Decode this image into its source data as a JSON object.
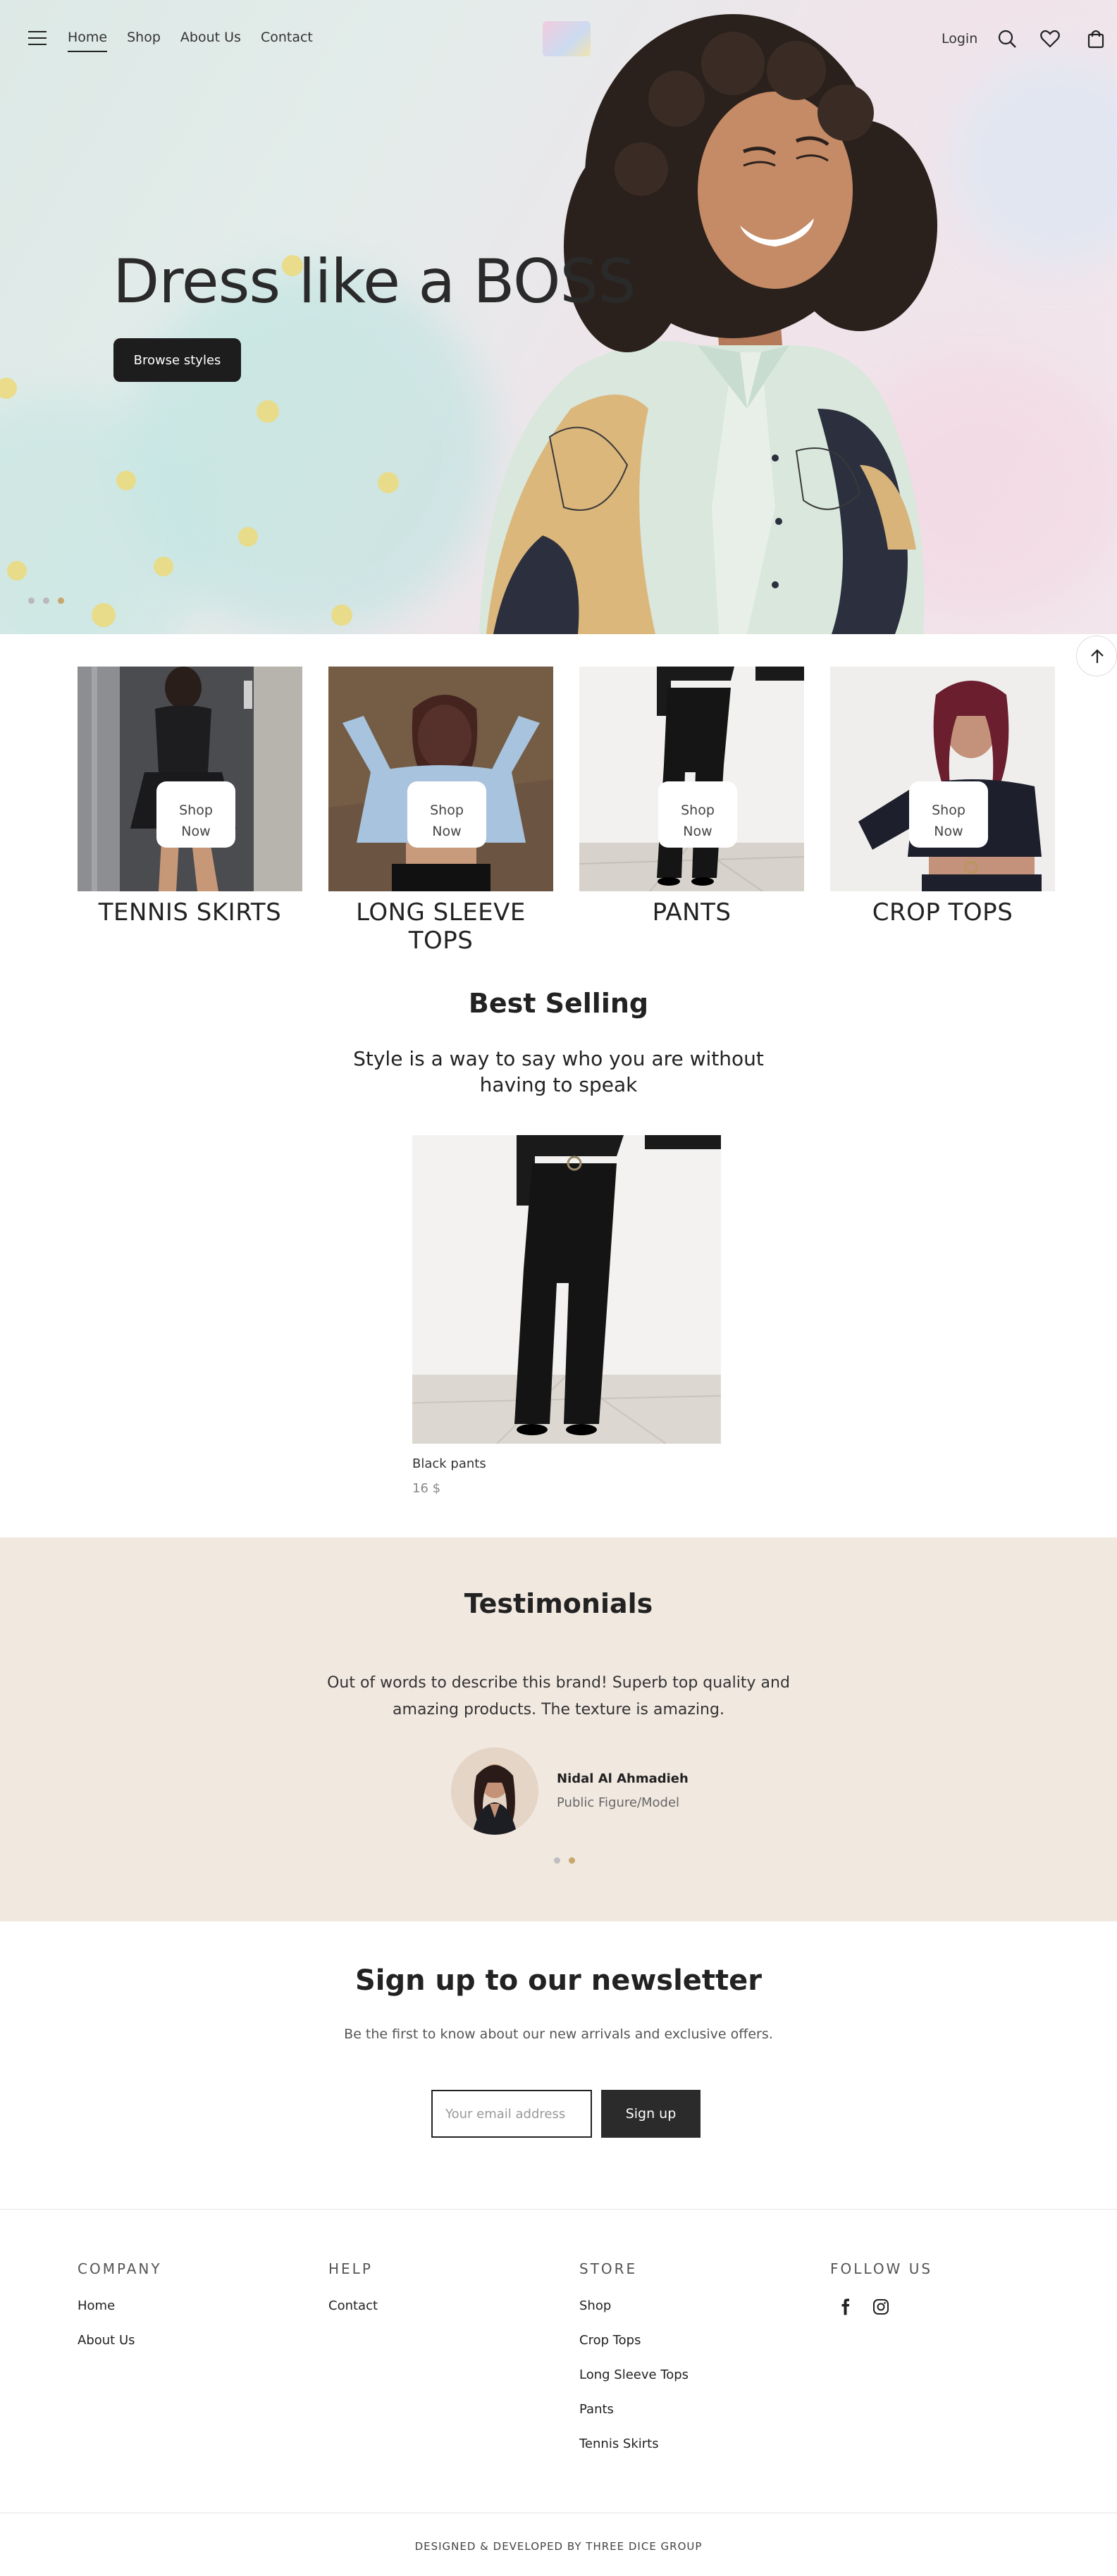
{
  "nav": {
    "links": [
      "Home",
      "Shop",
      "About Us",
      "Contact"
    ],
    "active": "Home",
    "login": "Login",
    "icons": [
      "menu-icon",
      "search-icon",
      "heart-icon",
      "cart-icon"
    ]
  },
  "hero": {
    "title": "Dress like a BOSS",
    "button": "Browse styles",
    "slides": 3,
    "active_slide": 3
  },
  "categories": [
    {
      "name": "TENNIS SKIRTS",
      "button": "Shop\nNow"
    },
    {
      "name": "LONG SLEEVE TOPS",
      "button": "Shop\nNow"
    },
    {
      "name": "PANTS",
      "button": "Shop\nNow"
    },
    {
      "name": "CROP TOPS",
      "button": "Shop\nNow"
    }
  ],
  "best_selling": {
    "title": "Best Selling",
    "subtitle": "Style is a way to say who you are without having to speak",
    "products": [
      {
        "name": "Black pants",
        "price": "16 $"
      }
    ]
  },
  "testimonials": {
    "title": "Testimonials",
    "quote": "Out of words to describe this brand! Superb top quality and amazing products. The texture is amazing.",
    "author": "Nidal Al Ahmadieh",
    "role": "Public Figure/Model",
    "slides": 2,
    "active_slide": 2
  },
  "newsletter": {
    "title": "Sign up to our newsletter",
    "subtitle": "Be the first to know about our new arrivals and exclusive offers.",
    "placeholder": "Your email address",
    "button": "Sign up"
  },
  "footer": {
    "company": {
      "heading": "COMPANY",
      "links": [
        "Home",
        "About Us"
      ]
    },
    "help": {
      "heading": "HELP",
      "links": [
        "Contact"
      ]
    },
    "store": {
      "heading": "STORE",
      "links": [
        "Shop",
        "Crop Tops",
        "Long Sleeve Tops",
        "Pants",
        "Tennis Skirts"
      ]
    },
    "follow": {
      "heading": "FOLLOW US",
      "icons": [
        "facebook-icon",
        "instagram-icon"
      ]
    },
    "copyright": "DESIGNED & DEVELOPED BY THREE DICE GROUP"
  },
  "colors": {
    "accent": "#c9a66b",
    "dark": "#1d1d1d",
    "testimonial_bg": "#f1e8e0"
  }
}
